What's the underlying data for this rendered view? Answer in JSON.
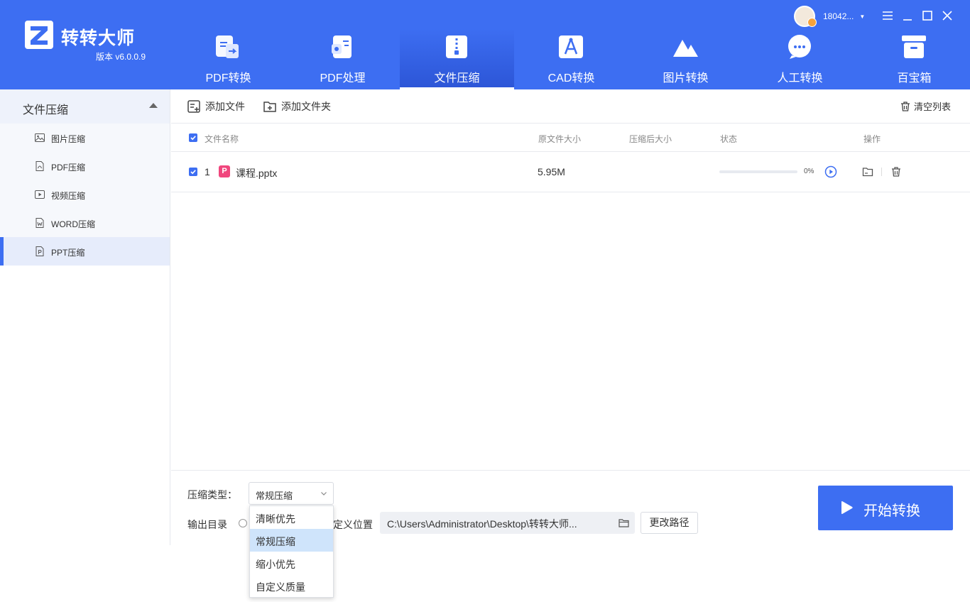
{
  "app": {
    "brand_name": "转转大师",
    "version": "版本 v6.0.0.9",
    "username": "18042...",
    "accent_color": "#3d6ef2"
  },
  "nav_tabs": [
    {
      "label": "PDF转换",
      "icon": "pdf-convert-icon",
      "active": false
    },
    {
      "label": "PDF处理",
      "icon": "pdf-process-icon",
      "active": false
    },
    {
      "label": "文件压缩",
      "icon": "file-compress-icon",
      "active": true
    },
    {
      "label": "CAD转换",
      "icon": "cad-convert-icon",
      "active": false
    },
    {
      "label": "图片转换",
      "icon": "image-convert-icon",
      "active": false
    },
    {
      "label": "人工转换",
      "icon": "manual-convert-icon",
      "active": false
    },
    {
      "label": "百宝箱",
      "icon": "toolbox-icon",
      "active": false
    }
  ],
  "sidebar": {
    "group_label": "文件压缩",
    "items": [
      {
        "label": "图片压缩",
        "icon": "image-icon",
        "active": false
      },
      {
        "label": "PDF压缩",
        "icon": "pdf-file-icon",
        "active": false
      },
      {
        "label": "视频压缩",
        "icon": "video-icon",
        "active": false
      },
      {
        "label": "WORD压缩",
        "icon": "word-file-icon",
        "active": false
      },
      {
        "label": "PPT压缩",
        "icon": "ppt-file-icon",
        "active": true
      }
    ]
  },
  "toolbar": {
    "add_file": "添加文件",
    "add_folder": "添加文件夹",
    "clear_list": "清空列表"
  },
  "table": {
    "columns": [
      "文件名称",
      "原文件大小",
      "压缩后大小",
      "状态",
      "操作"
    ],
    "rows": [
      {
        "index": "1",
        "badge": "P",
        "name": "课程.pptx",
        "original_size": "5.95M",
        "compressed_size": "",
        "progress_percent": 0,
        "progress_text": "0%"
      }
    ]
  },
  "settings": {
    "compress_type_label": "压缩类型：",
    "compress_type_value": "常规压缩",
    "output_dir_label": "输出目录",
    "custom_location_label": "定义位置",
    "output_path": "C:\\Users\\Administrator\\Desktop\\转转大师...",
    "change_path_button": "更改路径",
    "start_button": "开始转换"
  },
  "dropdown": {
    "options": [
      "清晰优先",
      "常规压缩",
      "缩小优先",
      "自定义质量"
    ],
    "selected_index": 1
  }
}
